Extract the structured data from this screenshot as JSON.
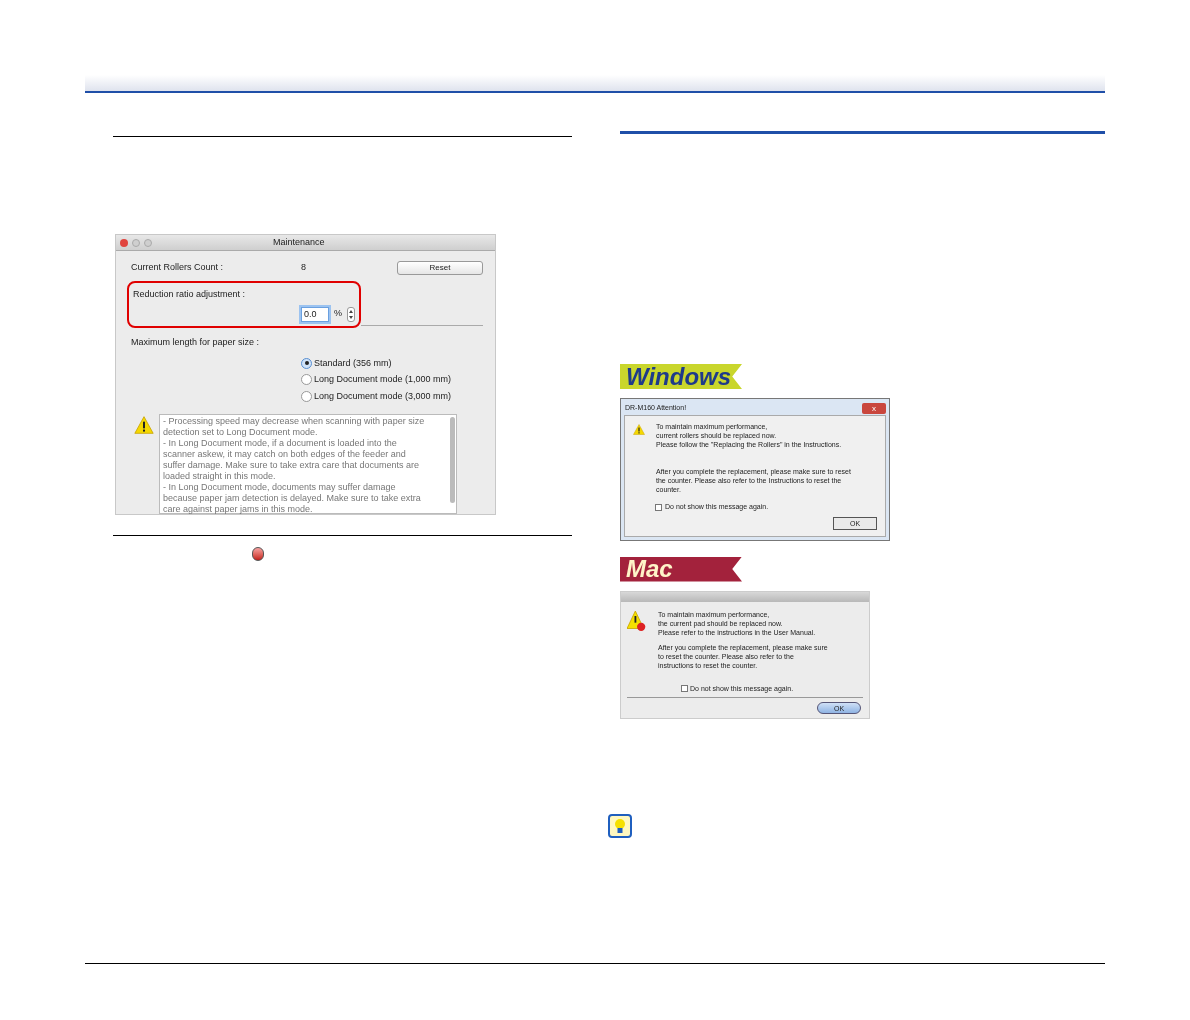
{
  "maintenance_dialog": {
    "title": "Maintenance",
    "rollers_label": "Current Rollers Count :",
    "rollers_value": "8",
    "reset_button": "Reset",
    "reduction_label": "Reduction ratio adjustment :",
    "reduction_value": "0.0",
    "reduction_unit": "%",
    "paper_size_label": "Maximum length for paper size :",
    "paper_size_options": [
      {
        "label": "Standard (356 mm)",
        "selected": true
      },
      {
        "label": "Long Document mode (1,000 mm)",
        "selected": false
      },
      {
        "label": "Long Document mode (3,000 mm)",
        "selected": false
      }
    ],
    "warning_lines": [
      "- Processing speed may decrease when scanning with paper size",
      "detection set to Long Document mode.",
      "- In Long Document mode, if a document is loaded into the",
      "scanner askew, it may catch on both edges of the feeder and",
      "suffer damage. Make sure to take extra care that documents are",
      "loaded straight in this mode.",
      "- In Long Document mode, documents may suffer damage",
      "because paper jam detection is delayed. Make sure to take extra",
      "care against paper jams in this mode."
    ]
  },
  "windows_badge": "Windows",
  "windows_dialog": {
    "title": "DR-M160 Attention!",
    "close_button": "x",
    "message_lines": [
      "To maintain maximum performance,",
      "current rollers should be replaced now.",
      "Please follow the \"Replacing the Rollers\" in the Instructions."
    ],
    "counter_lines": [
      "After you complete the replacement, please make sure to reset",
      "the counter. Please also refer to the Instructions to reset the",
      "counter."
    ],
    "checkbox": {
      "label": "Do not show this message again.",
      "checked": false
    },
    "ok_button": "OK"
  },
  "mac_badge": "Mac",
  "mac_dialog": {
    "message_lines": [
      "To maintain maximum performance,",
      "the current pad should be replaced now.",
      "Please refer to the instructions in the User Manual."
    ],
    "counter_lines": [
      "After you complete the replacement, please make sure",
      "to reset the counter. Please also refer to the",
      "instructions to reset the counter."
    ],
    "checkbox": {
      "label": "Do not show this message again.",
      "checked": false
    },
    "ok_button": "OK"
  }
}
